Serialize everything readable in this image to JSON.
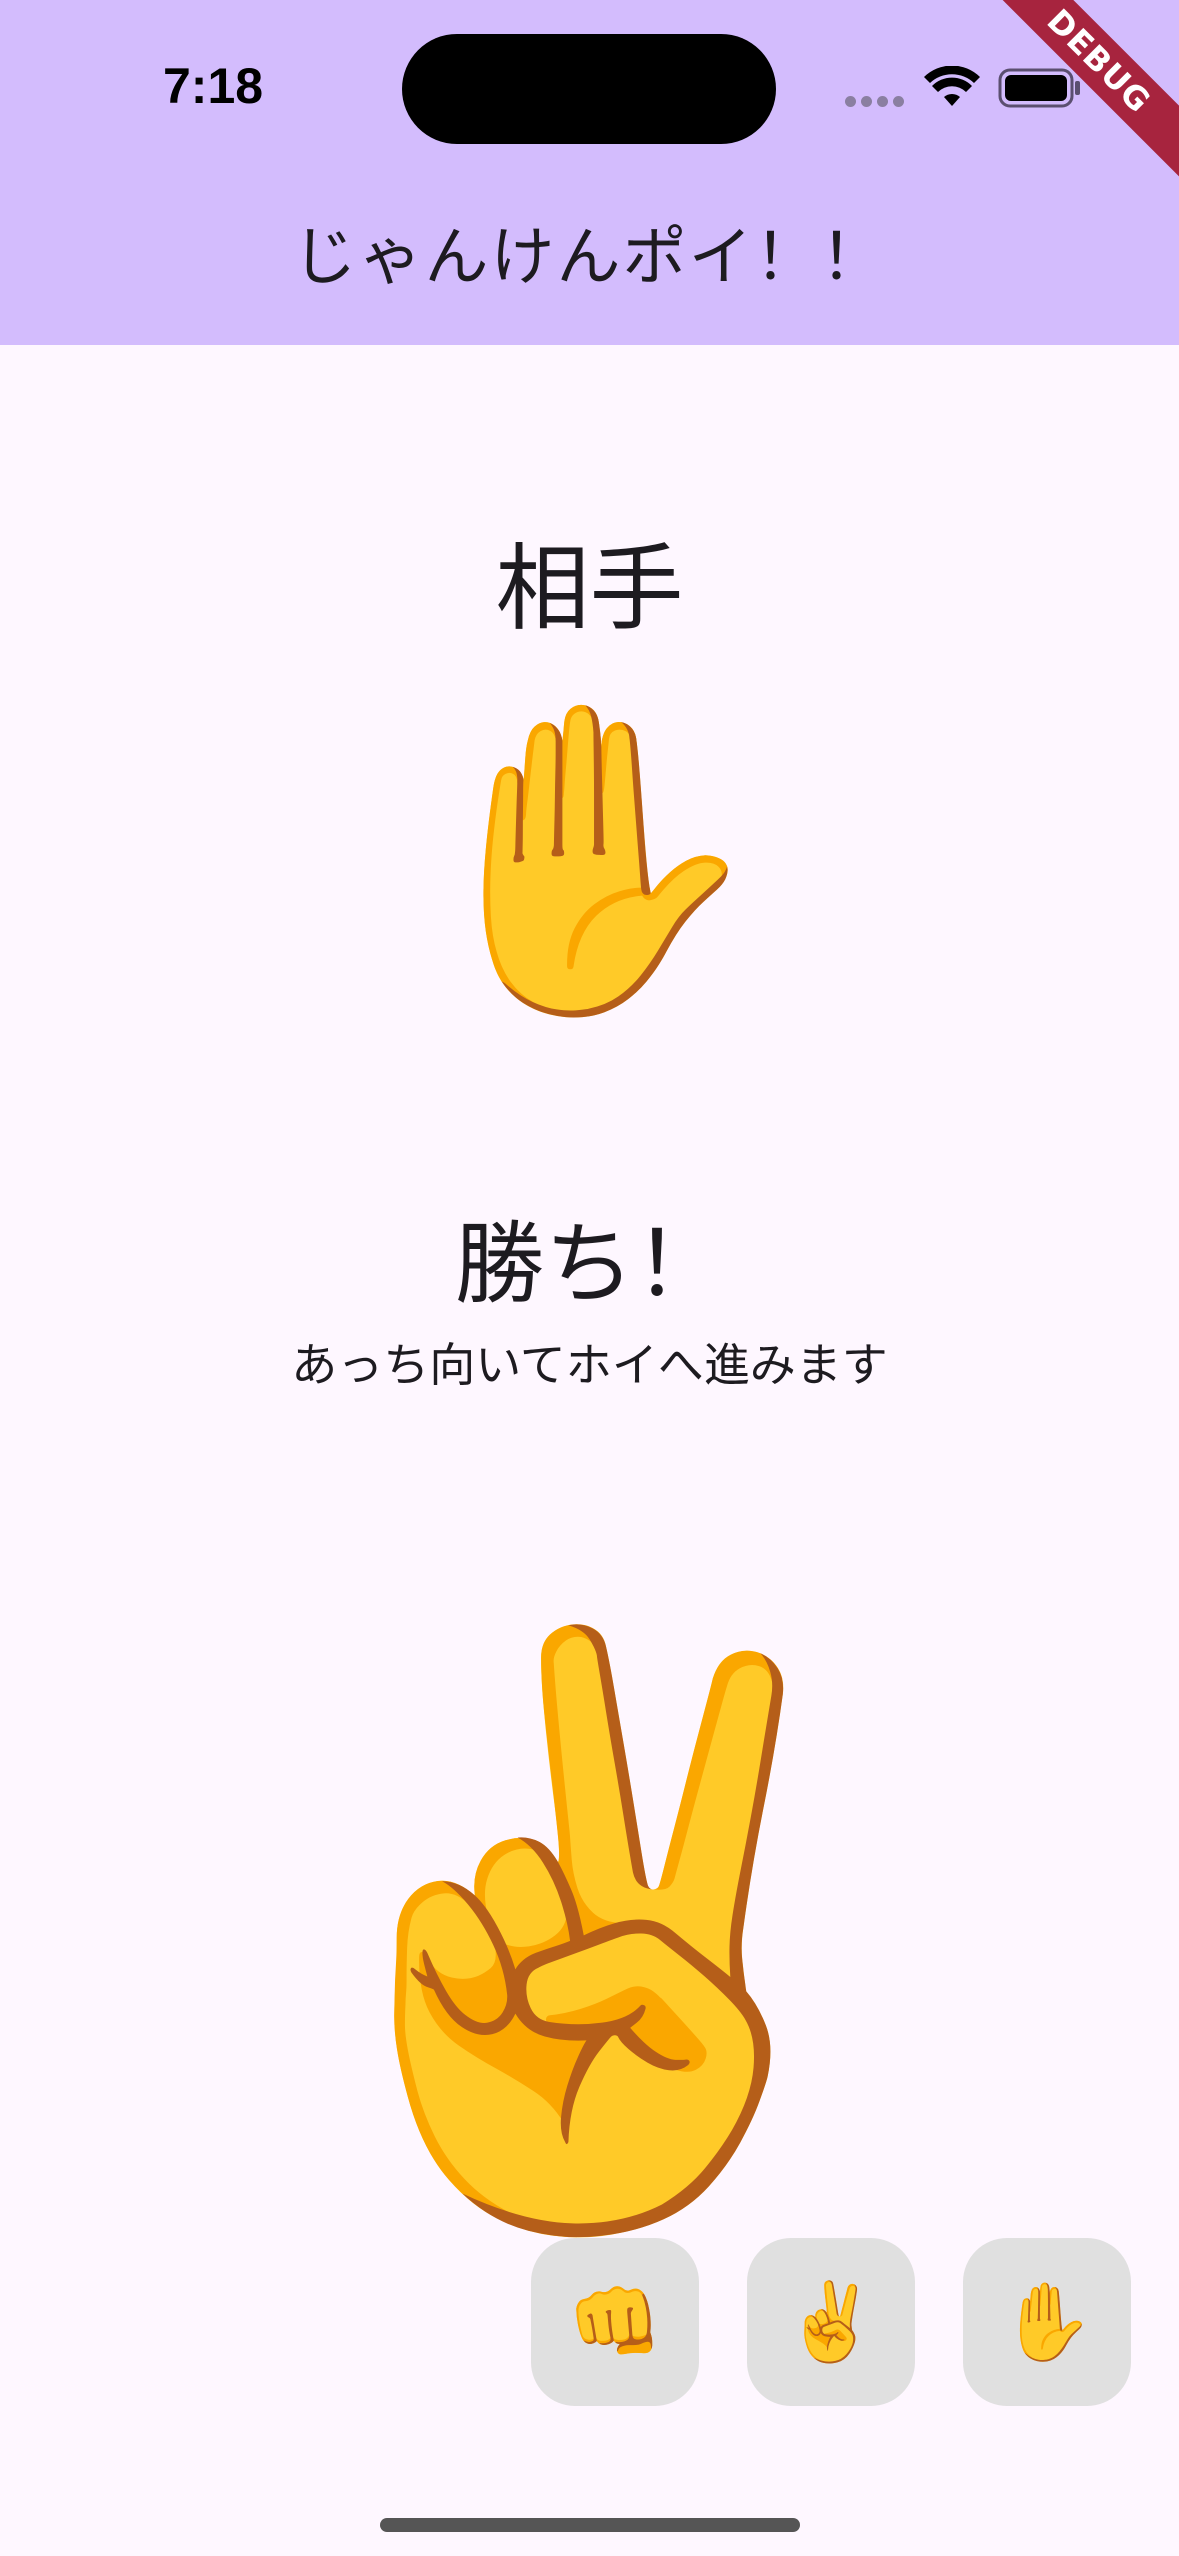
{
  "status_bar": {
    "time": "7:18",
    "debug_label": "DEBUG"
  },
  "app_bar": {
    "title": "じゃんけんポイ！！"
  },
  "opponent": {
    "label": "相手",
    "hand": "✋"
  },
  "result": {
    "title": "勝ち！",
    "message": "あっち向いてホイへ進みます"
  },
  "player": {
    "hand": "✌️"
  },
  "choices": [
    {
      "icon": "👊",
      "icon_name": "fist-icon"
    },
    {
      "icon": "✌️",
      "icon_name": "victory-hand-icon"
    },
    {
      "icon": "✋",
      "icon_name": "raised-hand-icon"
    }
  ],
  "colors": {
    "app_bar": "#d3bcfd",
    "background": "#fef7ff",
    "button": "#e0e0e0",
    "debug_banner": "#a7243e"
  }
}
